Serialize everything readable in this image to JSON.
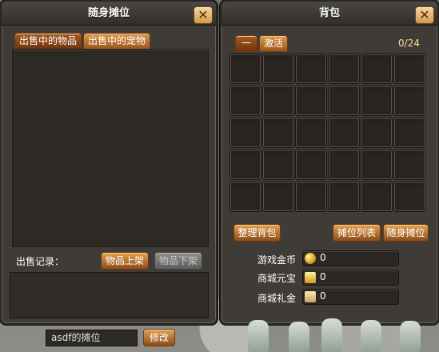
{
  "left_panel": {
    "title": "随身摊位",
    "tabs": [
      "出售中的物品",
      "出售中的宠物"
    ],
    "record_label": "出售记录：",
    "buttons": {
      "list": "物品上架",
      "delist": "物品下架",
      "modify": "修改"
    },
    "stall_name": "asdf的摊位"
  },
  "right_panel": {
    "title": "背包",
    "tabs": [
      "一",
      "激活"
    ],
    "capacity": "0/24",
    "buttons": {
      "sort": "整理背包",
      "stall_list": "摊位列表",
      "portable_stall": "随身摊位"
    },
    "currencies": [
      {
        "label": "游戏金币",
        "value": "0",
        "icon": "gold-coin-icon"
      },
      {
        "label": "商城元宝",
        "value": "0",
        "icon": "ingot-icon"
      },
      {
        "label": "商城礼金",
        "value": "0",
        "icon": "gift-money-icon"
      }
    ]
  }
}
